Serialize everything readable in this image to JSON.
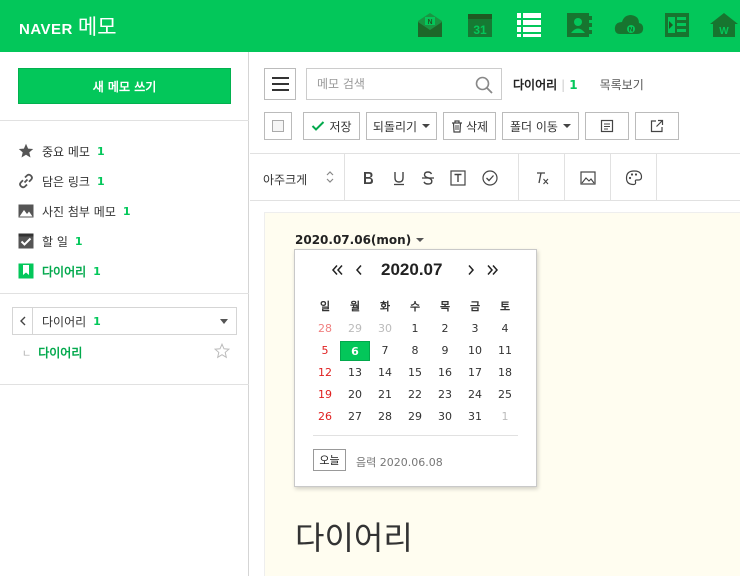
{
  "header": {
    "brand": "NAVER",
    "title": "메모",
    "apps": [
      {
        "icon": "mail-icon",
        "label": "N"
      },
      {
        "icon": "calendar-icon",
        "label": "31"
      },
      {
        "icon": "memo-list-icon",
        "label": ""
      },
      {
        "icon": "contacts-icon",
        "label": ""
      },
      {
        "icon": "cloud-icon",
        "label": "N"
      },
      {
        "icon": "office-icon",
        "label": ""
      },
      {
        "icon": "home-icon",
        "label": "W"
      }
    ]
  },
  "sidebar": {
    "new_memo_label": "새 메모 쓰기",
    "items": [
      {
        "icon": "star-icon",
        "label": "중요 메모",
        "count": "1"
      },
      {
        "icon": "link-icon",
        "label": "담은 링크",
        "count": "1"
      },
      {
        "icon": "image-icon",
        "label": "사진 첨부 메모",
        "count": "1"
      },
      {
        "icon": "checkbox-icon",
        "label": "할 일",
        "count": "1"
      },
      {
        "icon": "bookmark-icon",
        "label": "다이어리",
        "count": "1"
      }
    ],
    "folder_select": {
      "name": "다이어리",
      "count": "1"
    },
    "folder_child": {
      "name": "다이어리"
    }
  },
  "toolbar": {
    "search_placeholder": "메모 검색",
    "view_active": "다이어리",
    "view_active_count": "1",
    "view_list_label": "목록보기",
    "save_label": "저장",
    "revert_label": "되돌리기",
    "delete_label": "삭제",
    "move_folder_label": "폴더 이동"
  },
  "format_bar": {
    "font_size_label": "아주크게"
  },
  "editor": {
    "date": "2020.07.06",
    "day_of_week": "(mon)",
    "title": "다이어리"
  },
  "calendar": {
    "month_label": "2020.07",
    "weekdays": [
      "일",
      "월",
      "화",
      "수",
      "목",
      "금",
      "토"
    ],
    "weeks": [
      [
        "28",
        "29",
        "30",
        "1",
        "2",
        "3",
        "4"
      ],
      [
        "5",
        "6",
        "7",
        "8",
        "9",
        "10",
        "11"
      ],
      [
        "12",
        "13",
        "14",
        "15",
        "16",
        "17",
        "18"
      ],
      [
        "19",
        "20",
        "21",
        "22",
        "23",
        "24",
        "25"
      ],
      [
        "26",
        "27",
        "28",
        "29",
        "30",
        "31",
        "1"
      ]
    ],
    "outside_days": [
      [
        0,
        0
      ],
      [
        0,
        1
      ],
      [
        0,
        2
      ],
      [
        4,
        6
      ]
    ],
    "selected_day": "6",
    "today_label": "오늘",
    "lunar_label": "음력 2020.06.08"
  },
  "colors": {
    "brand_green": "#03c75a",
    "sunday_red": "#e02020"
  }
}
